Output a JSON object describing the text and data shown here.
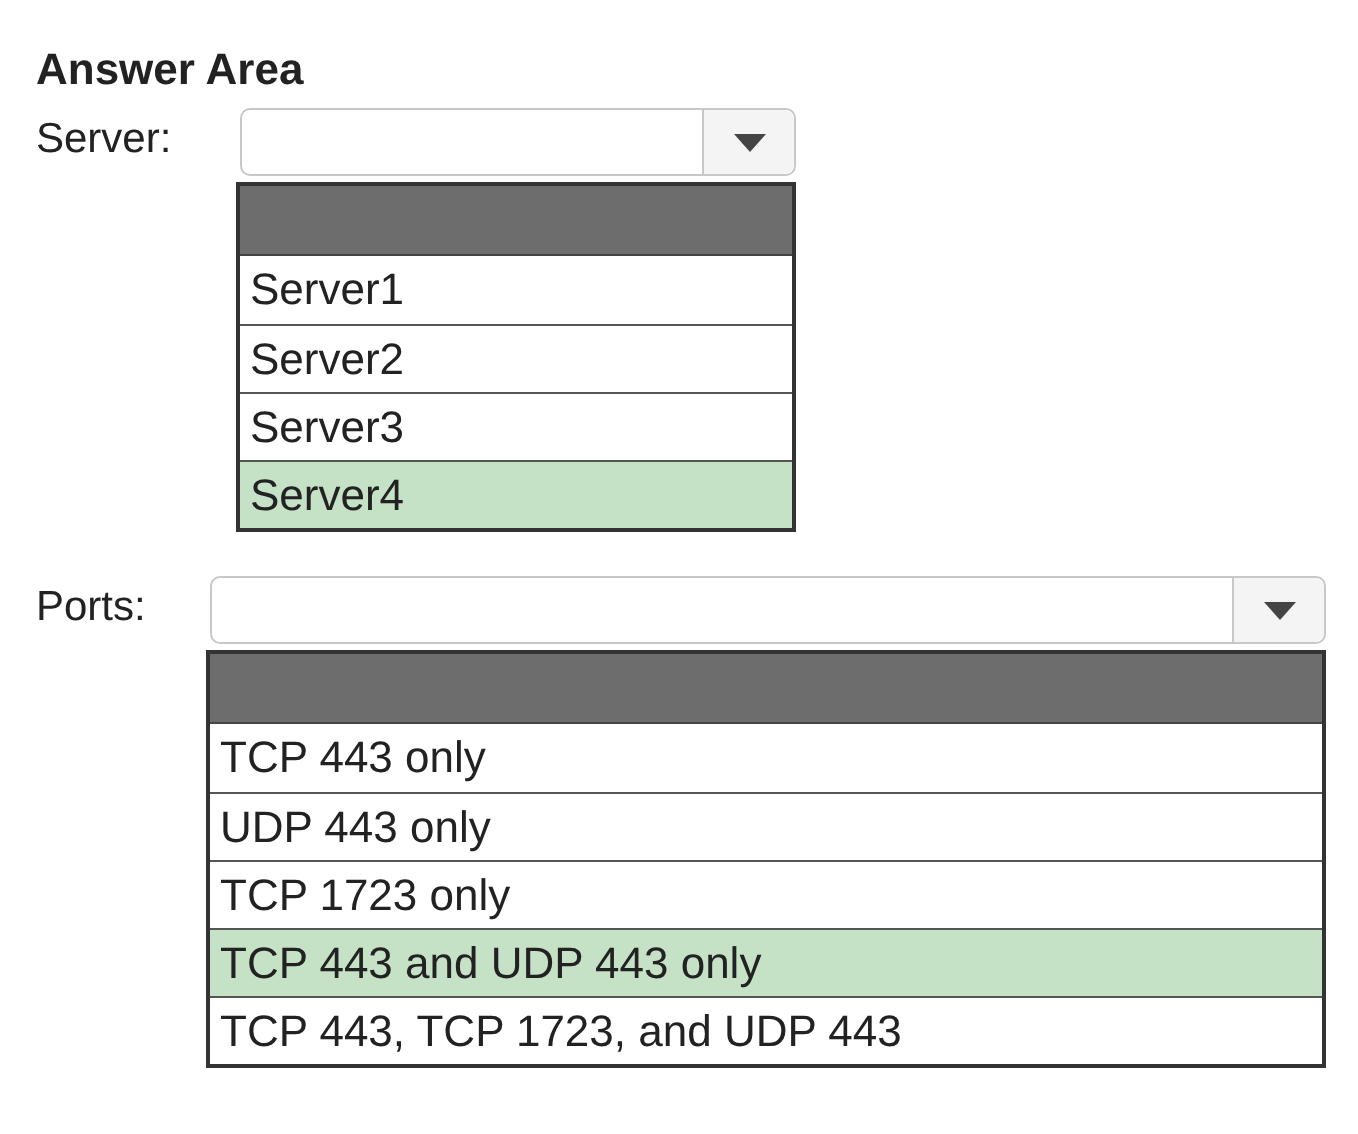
{
  "title": "Answer Area",
  "questions": [
    {
      "label": "Server:",
      "options": [
        {
          "label": "Server1",
          "selected": false
        },
        {
          "label": "Server2",
          "selected": false
        },
        {
          "label": "Server3",
          "selected": false
        },
        {
          "label": "Server4",
          "selected": true
        }
      ]
    },
    {
      "label": "Ports:",
      "options": [
        {
          "label": "TCP 443 only",
          "selected": false
        },
        {
          "label": "UDP 443 only",
          "selected": false
        },
        {
          "label": "TCP 1723 only",
          "selected": false
        },
        {
          "label": "TCP 443 and UDP 443 only",
          "selected": true
        },
        {
          "label": "TCP 443, TCP 1723, and UDP 443",
          "selected": false
        }
      ]
    }
  ]
}
